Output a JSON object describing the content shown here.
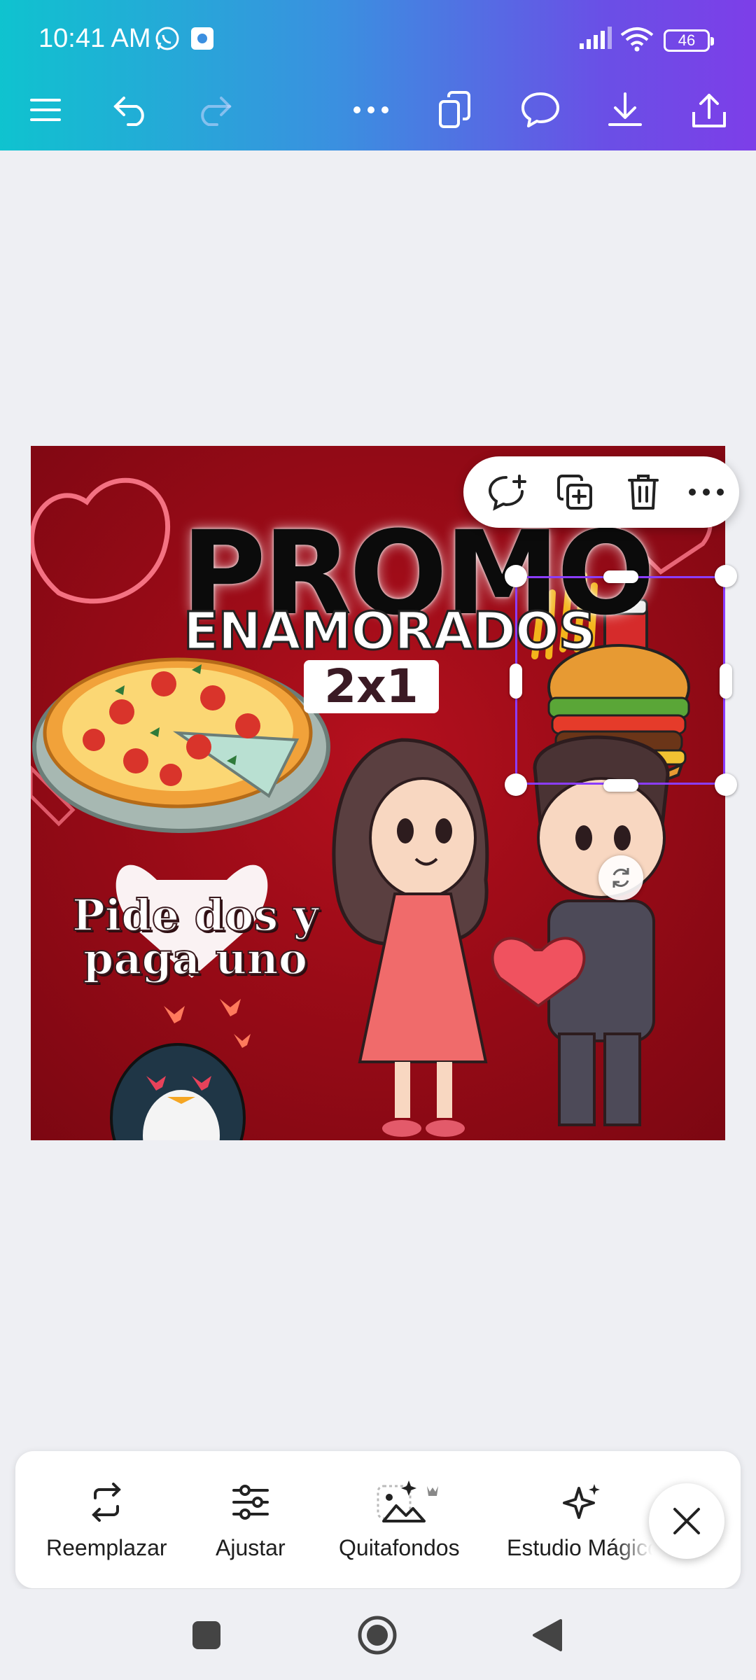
{
  "status_bar": {
    "time": "10:41 AM",
    "battery": "46"
  },
  "toolbar": {
    "menu_icon": "hamburger-icon",
    "undo_icon": "undo-icon",
    "redo_icon": "redo-icon",
    "more_icon": "more-icon",
    "pages_icon": "pages-icon",
    "comment_icon": "comment-icon",
    "download_icon": "download-icon",
    "share_icon": "share-icon"
  },
  "design": {
    "headline": "PROMO",
    "subheadline": "ENAMORADOS",
    "badge": "2x1",
    "tagline_line1": "Pide dos y",
    "tagline_line2": "paga uno"
  },
  "element_toolbar": {
    "add_comment_icon": "add-comment-icon",
    "duplicate_icon": "duplicate-icon",
    "delete_icon": "trash-icon",
    "more_icon": "more-icon"
  },
  "bottom_panel": {
    "items": [
      {
        "label": "Reemplazar",
        "icon": "replace-icon"
      },
      {
        "label": "Ajustar",
        "icon": "adjust-icon"
      },
      {
        "label": "Quitafondos",
        "icon": "bg-remover-icon"
      },
      {
        "label": "Estudio Mágico",
        "icon": "magic-studio-icon"
      }
    ],
    "close_icon": "close-icon"
  },
  "colors": {
    "accent": "#8b3dff",
    "gradient_start": "#0fc3cf",
    "gradient_end": "#7d3ee8",
    "design_bg": "#9a0b17"
  }
}
